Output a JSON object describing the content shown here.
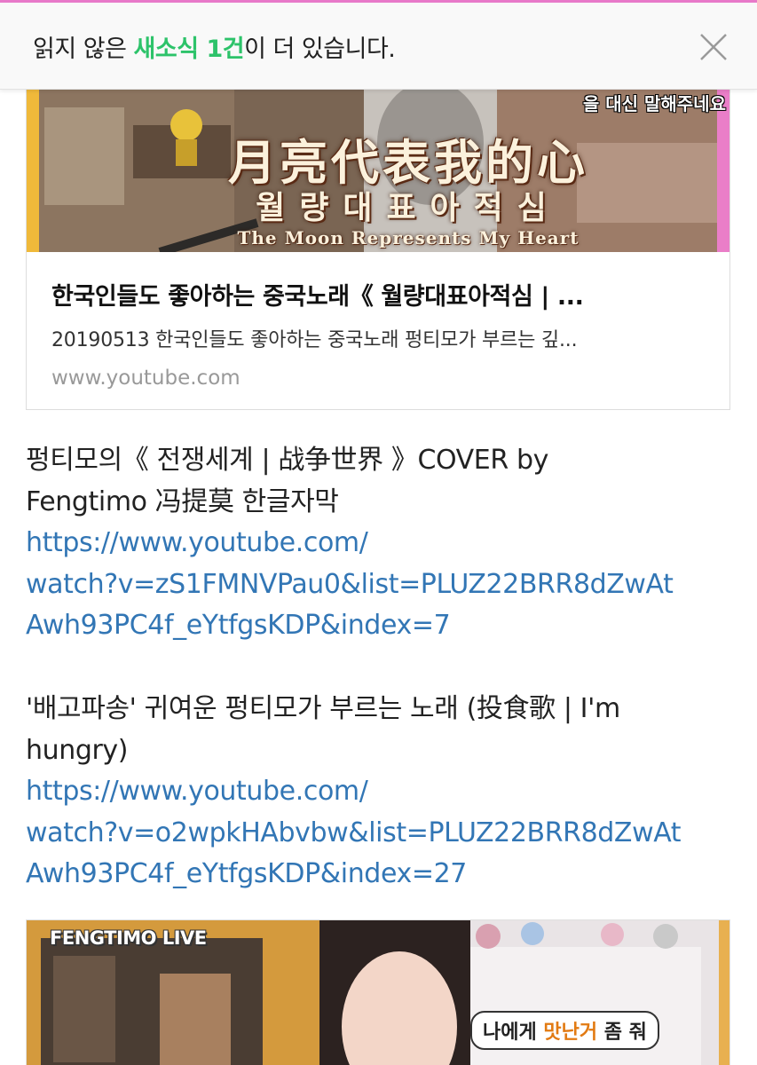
{
  "notification": {
    "prefix": "읽지 않은 ",
    "highlight": "새소식 1건",
    "suffix": "이 더 있습니다.",
    "close_icon": "close-icon"
  },
  "link_card": {
    "thumbnail": {
      "title_cn": "月亮代表我的心",
      "title_kr": "월량대표아적심",
      "title_en": "The Moon Represents My Heart",
      "caption": "을 대신 말해주네요"
    },
    "title": "한국인들도 좋아하는 중국노래《 월량대표아적심 | ...",
    "description": "20190513 한국인들도 좋아하는 중국노래 펑티모가 부르는 깊...",
    "domain": "www.youtube.com"
  },
  "posts": [
    {
      "text_lines": [
        "펑티모의《 전쟁세계 | 战争世界 》COVER by",
        "Fengtimo 冯提莫 한글자막"
      ],
      "link_lines": [
        "https://www.youtube.com/",
        "watch?v=zS1FMNVPau0&list=PLUZ22BRR8dZwAt",
        "Awh93PC4f_eYtfgsKDP&index=7"
      ]
    },
    {
      "text_lines": [
        "'배고파송' 귀여운 펑티모가 부르는 노래 (投食歌 | I'm",
        "hungry)"
      ],
      "link_lines": [
        "https://www.youtube.com/",
        "watch?v=o2wpkHAbvbw&list=PLUZ22BRR8dZwAt",
        "Awh93PC4f_eYtfgsKDP&index=27"
      ]
    }
  ],
  "video_card": {
    "live_label": "FENGTIMO LIVE",
    "bubble_prefix": "나에게 ",
    "bubble_highlight": "맛난거",
    "bubble_suffix": " 좀 줘"
  },
  "colors": {
    "accent_green": "#2dc36a",
    "link_blue": "#3276b5",
    "top_accent_pink": "#e879c9"
  }
}
